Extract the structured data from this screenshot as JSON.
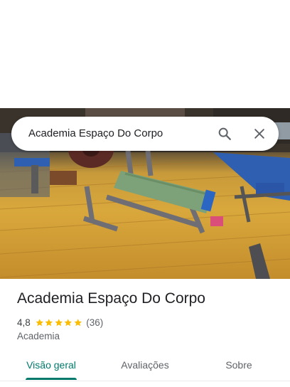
{
  "search": {
    "query": "Academia Espaço Do Corpo"
  },
  "hero": {
    "alt": "Foto da academia"
  },
  "place": {
    "title": "Academia Espaço Do Corpo",
    "rating": "4,8",
    "rating_value": 4.8,
    "stars": 5,
    "review_count": "(36)",
    "category": "Academia"
  },
  "tabs": [
    {
      "label": "Visão geral",
      "active": true
    },
    {
      "label": "Avaliações",
      "active": false
    },
    {
      "label": "Sobre",
      "active": false
    }
  ],
  "colors": {
    "accent": "#00796b",
    "star": "#fbbc04",
    "text_primary": "#202124",
    "text_secondary": "#5f6368"
  },
  "icons": {
    "search": "search-icon",
    "close": "close-icon",
    "star": "star-icon"
  }
}
